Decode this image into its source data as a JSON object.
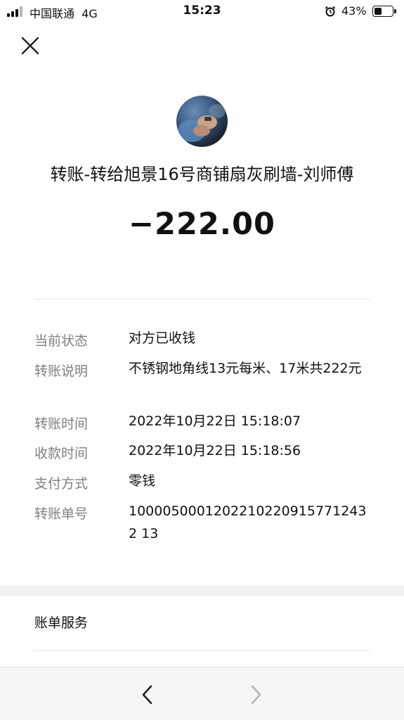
{
  "status_bar": {
    "carrier": "中国联通",
    "network": "4G",
    "time": "15:23",
    "battery_percent": "43%",
    "battery_level": 0.43
  },
  "transfer": {
    "title": "转账-转给旭景16号商铺扇灰刷墙-刘师傅",
    "amount": "−222.00"
  },
  "details": [
    {
      "label": "当前状态",
      "value": "对方已收钱"
    },
    {
      "label": "转账说明",
      "value": "不锈钢地角线13元每米、17米共222元"
    },
    {
      "label": "转账时间",
      "value": "2022年10月22日 15:18:07"
    },
    {
      "label": "收款时间",
      "value": "2022年10月22日 15:18:56"
    },
    {
      "label": "支付方式",
      "value": "零钱"
    },
    {
      "label": "转账单号",
      "value": "10000500012022102209157712432 13"
    }
  ],
  "bill_service": "账单服务",
  "icons": {
    "close": "close-icon",
    "back": "chevron-left-icon",
    "forward": "chevron-right-icon",
    "alarm": "alarm-icon"
  }
}
